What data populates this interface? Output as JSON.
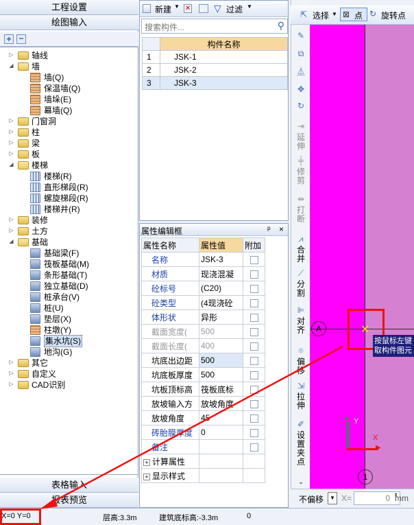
{
  "nav": {
    "project_settings": "工程设置",
    "drawing_input": "绘图输入",
    "table_input": "表格输入",
    "report_preview": "报表预览"
  },
  "tree": {
    "items": [
      {
        "label": "轴线",
        "level": 0,
        "expanded": false,
        "icon": "folder-icon"
      },
      {
        "label": "墙",
        "level": 0,
        "expanded": true,
        "icon": "folder-open-icon"
      },
      {
        "label": "墙(Q)",
        "level": 1,
        "icon": "wall-icon"
      },
      {
        "label": "保温墙(Q)",
        "level": 1,
        "icon": "insulated-wall-icon"
      },
      {
        "label": "墙垛(E)",
        "level": 1,
        "icon": "wall-pier-icon"
      },
      {
        "label": "幕墙(Q)",
        "level": 1,
        "icon": "curtain-wall-icon"
      },
      {
        "label": "门窗洞",
        "level": 0,
        "expanded": false,
        "icon": "folder-icon"
      },
      {
        "label": "柱",
        "level": 0,
        "expanded": false,
        "icon": "folder-icon"
      },
      {
        "label": "梁",
        "level": 0,
        "expanded": false,
        "icon": "folder-icon"
      },
      {
        "label": "板",
        "level": 0,
        "expanded": false,
        "icon": "folder-icon"
      },
      {
        "label": "楼梯",
        "level": 0,
        "expanded": true,
        "icon": "folder-open-icon"
      },
      {
        "label": "楼梯(R)",
        "level": 1,
        "icon": "stair-icon"
      },
      {
        "label": "直形梯段(R)",
        "level": 1,
        "icon": "straight-flight-icon"
      },
      {
        "label": "螺旋梯段(R)",
        "level": 1,
        "icon": "spiral-flight-icon"
      },
      {
        "label": "楼梯井(R)",
        "level": 1,
        "icon": "stairwell-icon"
      },
      {
        "label": "装修",
        "level": 0,
        "expanded": false,
        "icon": "folder-icon"
      },
      {
        "label": "土方",
        "level": 0,
        "expanded": false,
        "icon": "folder-icon"
      },
      {
        "label": "基础",
        "level": 0,
        "expanded": true,
        "icon": "folder-open-icon"
      },
      {
        "label": "基础梁(F)",
        "level": 1,
        "icon": "foundation-beam-icon"
      },
      {
        "label": "筏板基础(M)",
        "level": 1,
        "icon": "raft-foundation-icon"
      },
      {
        "label": "条形基础(T)",
        "level": 1,
        "icon": "strip-foundation-icon"
      },
      {
        "label": "独立基础(D)",
        "level": 1,
        "icon": "isolated-foundation-icon"
      },
      {
        "label": "桩承台(V)",
        "level": 1,
        "icon": "pile-cap-icon"
      },
      {
        "label": "桩(U)",
        "level": 1,
        "icon": "pile-icon"
      },
      {
        "label": "垫层(X)",
        "level": 1,
        "icon": "cushion-icon"
      },
      {
        "label": "柱墩(Y)",
        "level": 1,
        "icon": "column-pier-icon"
      },
      {
        "label": "集水坑(S)",
        "level": 1,
        "icon": "sump-pit-icon",
        "selected": true
      },
      {
        "label": "地沟(G)",
        "level": 1,
        "icon": "trench-icon"
      },
      {
        "label": "其它",
        "level": 0,
        "expanded": false,
        "icon": "folder-icon"
      },
      {
        "label": "自定义",
        "level": 0,
        "expanded": false,
        "icon": "folder-icon"
      },
      {
        "label": "CAD识别",
        "level": 0,
        "expanded": false,
        "icon": "folder-icon"
      }
    ]
  },
  "components": {
    "new_label": "新建",
    "filter_label": "过滤",
    "search_placeholder": "搜索构件...",
    "header": "构件名称",
    "rows": [
      {
        "no": "1",
        "name": "JSK-1"
      },
      {
        "no": "2",
        "name": "JSK-2"
      },
      {
        "no": "3",
        "name": "JSK-3",
        "selected": true
      }
    ]
  },
  "props": {
    "title": "属性编辑框",
    "pin": "ᵖ",
    "close": "×",
    "headers": {
      "name": "属性名称",
      "value": "属性值",
      "extra": "附加"
    },
    "rows": [
      {
        "name": "名称",
        "value": "JSK-3",
        "link": true
      },
      {
        "name": "材质",
        "value": "现浇混凝",
        "link": true
      },
      {
        "name": "砼标号",
        "value": "(C20)",
        "link": true
      },
      {
        "name": "砼类型",
        "value": "(4现浇砼",
        "link": true
      },
      {
        "name": "体形状",
        "value": "异形",
        "link": true
      },
      {
        "name": "截面宽度(",
        "value": "500",
        "gray": true
      },
      {
        "name": "截面长度(",
        "value": "400",
        "gray": true
      },
      {
        "name": "坑底出边距",
        "value": "500",
        "hl": true
      },
      {
        "name": "坑底板厚度",
        "value": "500"
      },
      {
        "name": "坑板顶标高",
        "value": "筏板底标"
      },
      {
        "name": "放坡输入方",
        "value": "放坡角度"
      },
      {
        "name": "放坡角度",
        "value": "45"
      },
      {
        "name": "砖胎膜厚度",
        "value": "0",
        "link": true
      },
      {
        "name": "备注",
        "value": "",
        "link": true
      }
    ],
    "groups": [
      "计算属性",
      "显示样式"
    ]
  },
  "side_tools": {
    "select": "选择",
    "point": "点",
    "rotate_point": "旋转点",
    "extend": "延伸",
    "trim": "修剪",
    "break": "打断",
    "merge": "合并",
    "split": "分割",
    "align": "对齐",
    "offset": "偏移",
    "stretch": "拉伸",
    "set_insert_point": "设置夹点"
  },
  "canvas": {
    "axis_a": "A",
    "axis_1": "1",
    "tooltip_line1": "按鼠标左键",
    "tooltip_line2": "取构件图元",
    "y_label": "Y",
    "x_label": "X"
  },
  "bottom_bar": {
    "no_offset": "不偏移",
    "x_label": "X=",
    "x_value": "0",
    "unit": "mm"
  },
  "status": {
    "coords": "X=0 Y=0",
    "floor_height": "层高:3.3m",
    "base_elevation": "建筑底标高:-3.3m",
    "extra": "0"
  },
  "colors": {
    "canvas": "#ff00ff",
    "highlight_box": "#ee1111",
    "annotation_arrow": "#ee1111",
    "selected_row": "#dde9f8"
  }
}
